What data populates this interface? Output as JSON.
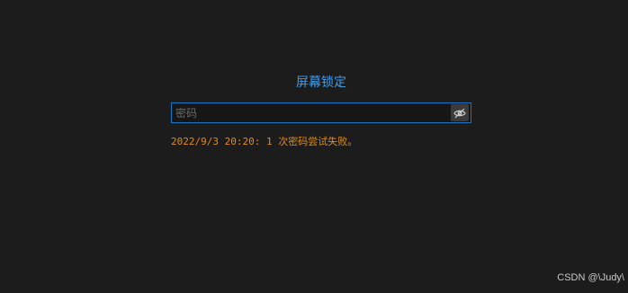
{
  "lock_screen": {
    "title": "屏幕锁定",
    "password_placeholder": "密码",
    "password_value": "",
    "reveal_icon": "eye-slash-icon",
    "failure_message": "2022/9/3 20:20: 1 次密码尝试失败。"
  },
  "watermark": {
    "text": "CSDN @\\Judy\\"
  },
  "colors": {
    "background": "#1c1c1c",
    "accent": "#3f9be8",
    "input_border": "#1477c4",
    "warning": "#e08b1c"
  }
}
